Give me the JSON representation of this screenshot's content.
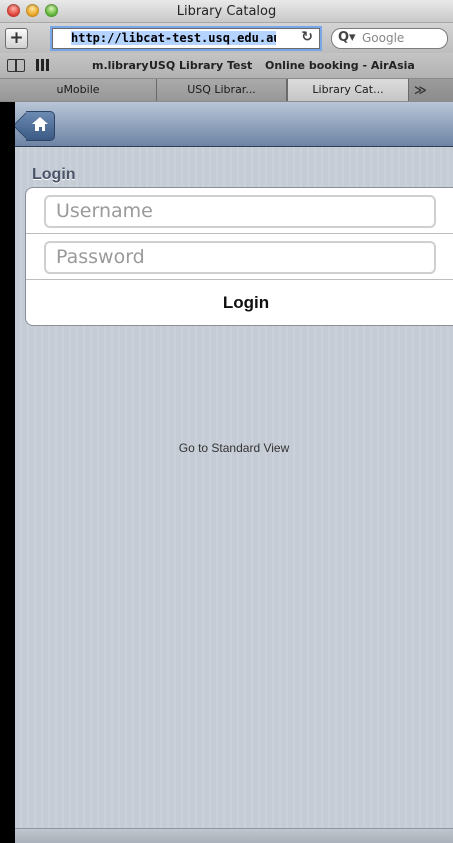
{
  "window": {
    "title": "Library Catalog"
  },
  "toolbar": {
    "add_label": "+",
    "url": "http://libcat-test.usq.edu.au/MyRe",
    "reload_glyph": "↻",
    "search_placeholder": "Google",
    "search_glyph": "Q▾"
  },
  "bookmarks": {
    "items": [
      {
        "label": "m.library"
      },
      {
        "label": "USQ Library Test"
      },
      {
        "label": "Online booking - AirAsia"
      }
    ]
  },
  "tabs": {
    "items": [
      {
        "label": "uMobile"
      },
      {
        "label": "USQ Librar..."
      },
      {
        "label": "Library Cat..."
      }
    ],
    "more_glyph": "≫"
  },
  "page": {
    "home_icon": "home-icon",
    "heading": "Login",
    "username_placeholder": "Username",
    "password_placeholder": "Password",
    "login_button": "Login",
    "standard_view_link": "Go to Standard View"
  },
  "colors": {
    "navbar": "#6d84a4",
    "background": "#c6ccd6",
    "url_focus": "#78a6e6"
  }
}
